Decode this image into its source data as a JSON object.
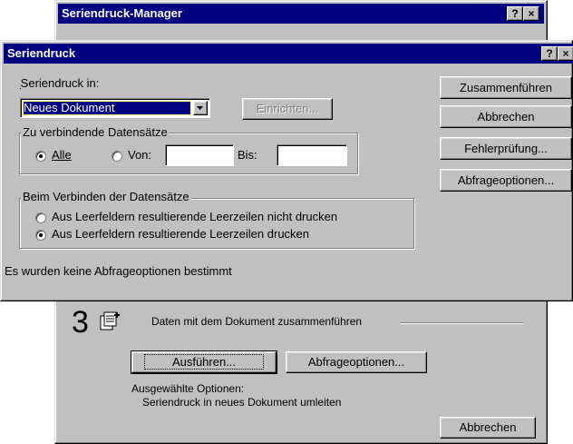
{
  "manager": {
    "title": "Seriendruck-Manager",
    "help_btn": "?",
    "close_btn": "×",
    "step_number": "3",
    "step_text": "Daten mit dem Dokument zusammenführen",
    "run_btn": "Ausführen...",
    "query_btn": "Abfrageoptionen...",
    "selected_label": "Ausgewählte Optionen:",
    "selected_value": "Seriendruck in neues Dokument umleiten",
    "cancel_btn": "Abbrechen"
  },
  "dialog": {
    "title": "Seriendruck",
    "help_btn": "?",
    "close_btn": "×",
    "target_label": "Seriendruck in:",
    "target_value": "Neues Dokument",
    "setup_btn": "Einrichten...",
    "records_legend": "Zu verbindende Datensätze",
    "radio_all": "Alle",
    "radio_from": "Von:",
    "to_label": "Bis:",
    "from_value": "",
    "to_value": "",
    "blank_legend": "Beim Verbinden der Datensätze",
    "blank_opt1": "Aus Leerfeldern resultierende Leerzeilen nicht drucken",
    "blank_opt2": "Aus Leerfeldern resultierende Leerzeilen drucken",
    "status": "Es wurden keine Abfrageoptionen bestimmt",
    "merge_btn": "Zusammenführen",
    "cancel_btn": "Abbrechen",
    "check_btn": "Fehlerprüfung...",
    "query_btn": "Abfrageoptionen..."
  },
  "colors": {
    "titlebar": "#000080",
    "face": "#c0c0c0"
  }
}
